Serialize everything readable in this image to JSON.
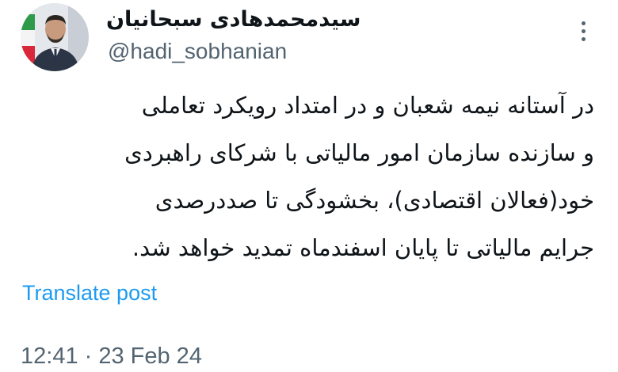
{
  "author": {
    "display_name": "سیدمحمدهادی سبحانیان",
    "handle": "@hadi_sobhanian",
    "avatar_icon": "profile-avatar"
  },
  "menu": {
    "icon": "more-vertical-icon"
  },
  "post": {
    "lines": [
      "در آستانه نیمه شعبان و در امتداد رویکرد تعاملی",
      "و سازنده سازمان امور مالیاتی با شرکای راهبردی",
      "خود(فعالان اقتصادی)، بخشودگی تا صددرصدی",
      "جرایم مالیاتی تا پایان اسفندماه تمدید خواهد شد."
    ]
  },
  "translate_label": "Translate post",
  "timestamp": "12:41 · 23 Feb 24",
  "colors": {
    "text": "#0f1419",
    "secondary": "#536471",
    "link": "#1d9bf0"
  }
}
